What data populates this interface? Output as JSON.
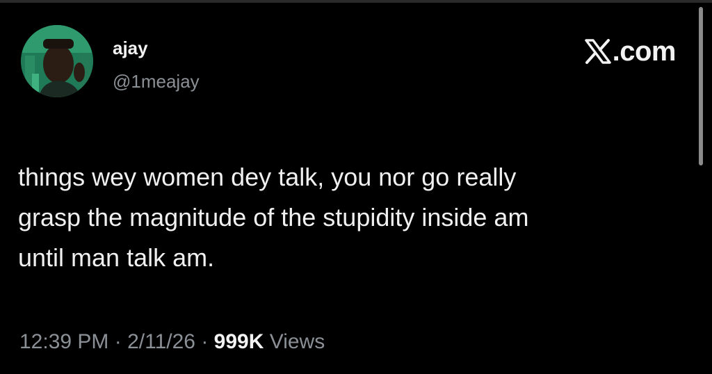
{
  "author": {
    "name": "ajay",
    "handle": "@1meajay",
    "avatar": "profile-photo"
  },
  "brand": {
    "icon": "x-logo-icon",
    "text": ".com"
  },
  "tweet": {
    "text": "things wey women dey talk, you nor go really\ngrasp the magnitude of the stupidity inside am\nuntil man talk am."
  },
  "meta": {
    "time": "12:39 PM",
    "separator": "·",
    "date": "2/11/26",
    "views_count": "999K",
    "views_label": "Views"
  },
  "colors": {
    "background": "#000000",
    "text_primary": "#f0f0f0",
    "text_secondary": "#8b9096",
    "avatar_bg": "#1d6b4f"
  }
}
